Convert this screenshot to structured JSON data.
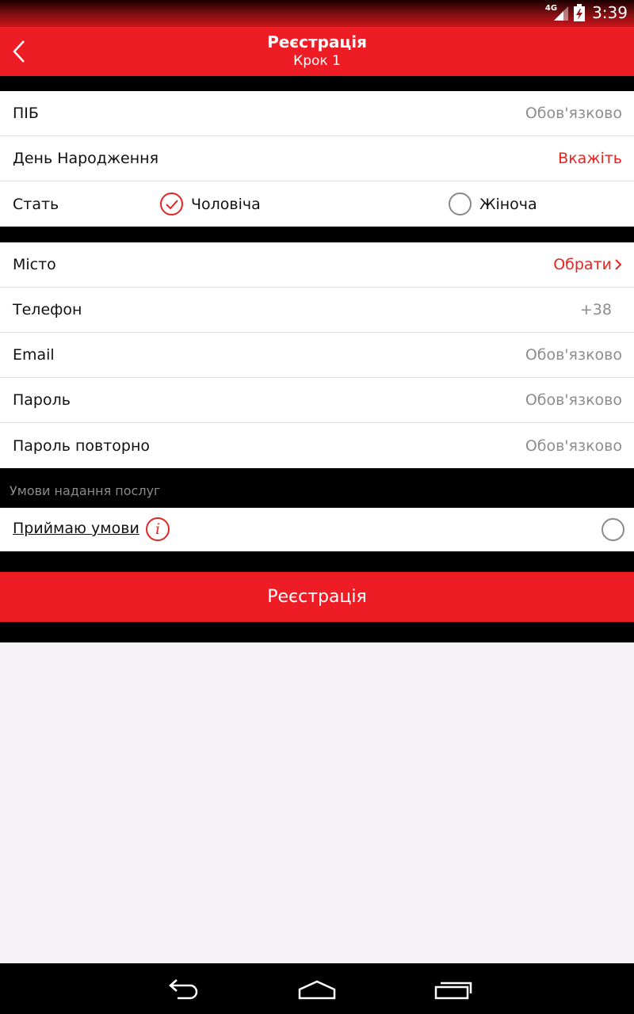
{
  "status": {
    "network": "4G",
    "time": "3:39"
  },
  "appbar": {
    "title": "Реєстрація",
    "subtitle": "Крок 1"
  },
  "form1": {
    "pib": {
      "label": "ПІБ",
      "placeholder": "Обов'язково"
    },
    "birthday": {
      "label": "День Народження",
      "value": "Вкажіть"
    },
    "gender": {
      "label": "Стать",
      "male": "Чоловіча",
      "female": "Жіноча",
      "selected": "male"
    }
  },
  "form2": {
    "city": {
      "label": "Місто",
      "value": "Обрати"
    },
    "phone": {
      "label": "Телефон",
      "placeholder": "+38"
    },
    "email": {
      "label": "Email",
      "placeholder": "Обов'язково"
    },
    "password": {
      "label": "Пароль",
      "placeholder": "Обов'язково"
    },
    "password_repeat": {
      "label": "Пароль повторно",
      "placeholder": "Обов'язково"
    }
  },
  "terms": {
    "section_header": "Умови надання послуг",
    "accept_label": "Приймаю умови",
    "info_glyph": "i"
  },
  "submit_label": "Реєстрація",
  "colors": {
    "accent": "#ee1c25",
    "accent_text": "#e52521",
    "placeholder": "#8d8d8d",
    "empty_bg": "#f5f2f5"
  },
  "icons": {
    "back": "chevron-left-icon",
    "nav_back": "back-arrow-icon",
    "nav_home": "home-icon",
    "nav_recents": "recents-icon"
  }
}
